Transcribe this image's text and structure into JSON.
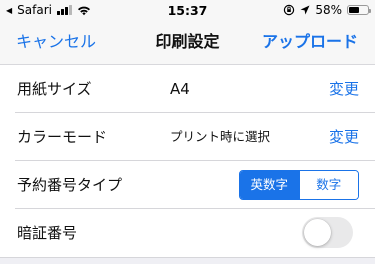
{
  "status_bar": {
    "carrier": "Safari",
    "time": "15:37",
    "battery_text": "58%",
    "battery_level": 0.58,
    "icons": [
      "cellular-signal-icon",
      "wifi-icon",
      "rotation-lock-icon",
      "location-arrow-icon",
      "battery-icon"
    ]
  },
  "nav": {
    "cancel_label": "キャンセル",
    "title": "印刷設定",
    "upload_label": "アップロード"
  },
  "settings": {
    "paper_size": {
      "label": "用紙サイズ",
      "value": "A4",
      "action": "変更"
    },
    "color_mode": {
      "label": "カラーモード",
      "value": "プリント時に選択",
      "action": "変更"
    },
    "reservation_type": {
      "label": "予約番号タイプ",
      "options": [
        "英数字",
        "数字"
      ],
      "selected": "英数字"
    },
    "pin": {
      "label": "暗証番号",
      "enabled": false
    }
  },
  "colors": {
    "accent": "#1a73e8",
    "background": "#efeff4",
    "bar": "#f7f7f7"
  }
}
